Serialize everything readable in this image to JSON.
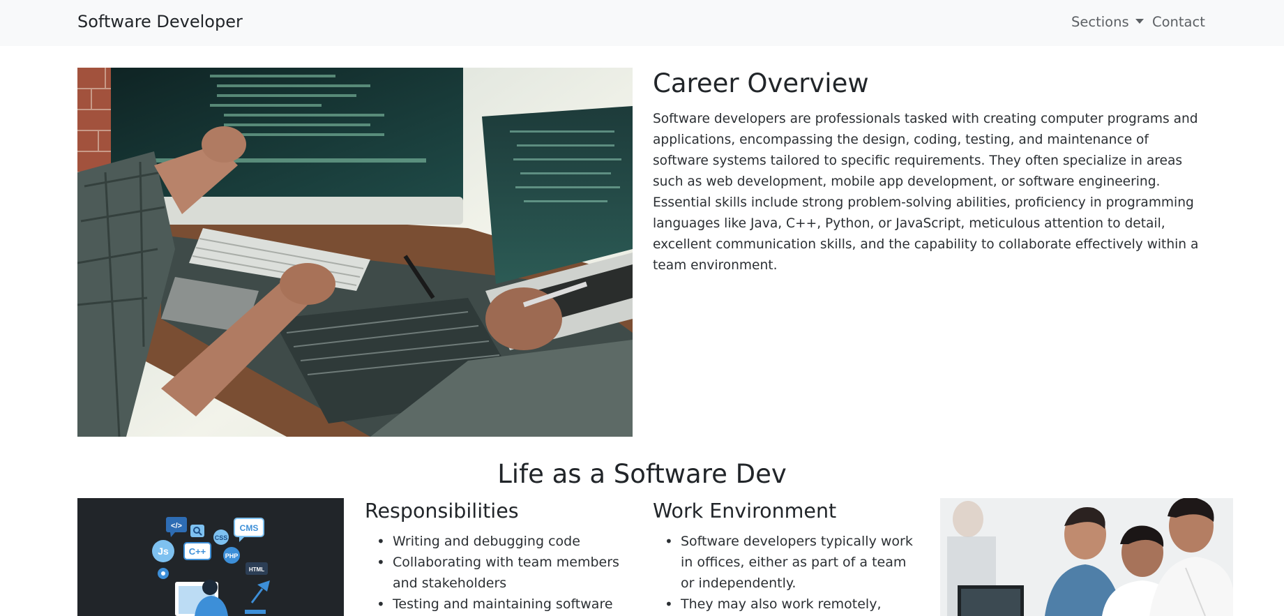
{
  "navbar": {
    "brand": "Software Developer",
    "sections_label": "Sections",
    "contact_label": "Contact"
  },
  "career": {
    "title": "Career Overview",
    "text": "Software developers are professionals tasked with creating computer programs and applications, encompassing the design, coding, testing, and maintenance of software systems tailored to specific requirements. They often specialize in areas such as web development, mobile app development, or software engineering. Essential skills include strong problem-solving abilities, proficiency in programming languages like Java, C++, Python, or JavaScript, meticulous attention to detail, excellent communication skills, and the capability to collaborate effectively within a team environment."
  },
  "life": {
    "title": "Life as a Software Dev"
  },
  "icons_illustration": {
    "badges": [
      "</>",
      "CMS",
      "Js",
      "C++",
      "CSS",
      "PHP",
      "HTML"
    ]
  },
  "responsibilities": {
    "title": "Responsibilities",
    "items": [
      "Writing and debugging code",
      "Collaborating with team members and stakeholders",
      "Testing and maintaining software"
    ]
  },
  "work_environment": {
    "title": "Work Environment",
    "items": [
      "Software developers typically work in offices, either as part of a team or independently.",
      "They may also work remotely,"
    ]
  },
  "colors": {
    "navbar_bg": "#f8f9fa",
    "text": "#212529",
    "nav_link": "#5c6064",
    "illustration_bg": "#212529",
    "accent_blue": "#3d8fd8"
  }
}
